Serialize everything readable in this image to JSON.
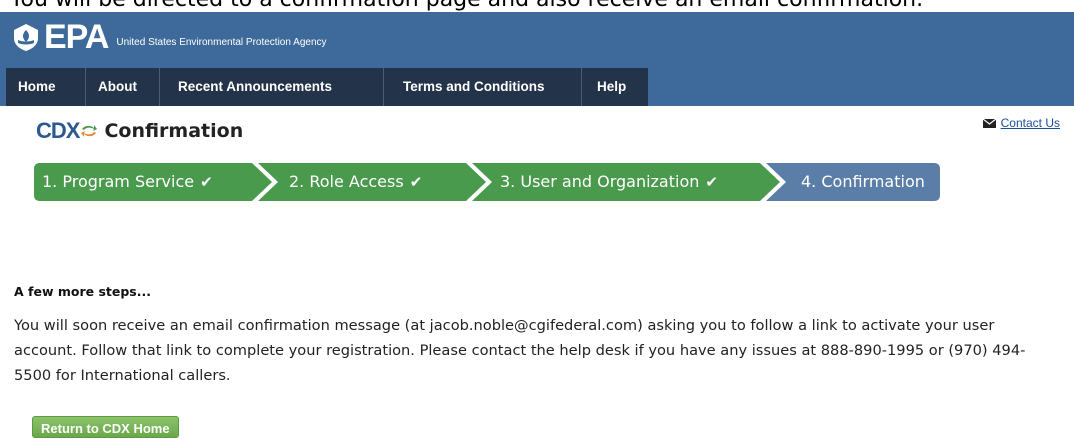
{
  "doc_caption": "You will be directed to a confirmation page and also receive an email confirmation.",
  "header": {
    "logo_text": "EPA",
    "agency_name": "United States Environmental Protection Agency"
  },
  "nav": {
    "items": [
      {
        "label": "Home"
      },
      {
        "label": "About"
      },
      {
        "label": "Recent Announcements"
      },
      {
        "label": "Terms and Conditions"
      },
      {
        "label": "Help"
      }
    ]
  },
  "contact": {
    "label": "Contact Us",
    "icon": "envelope-icon"
  },
  "title": {
    "logo_text": "CDX",
    "text": "Confirmation"
  },
  "steps": [
    {
      "label": "1. Program Service",
      "check": "✔",
      "state": "complete"
    },
    {
      "label": "2. Role Access",
      "check": "✔",
      "state": "complete"
    },
    {
      "label": "3. User and Organization",
      "check": "✔",
      "state": "complete"
    },
    {
      "label": "4. Confirmation",
      "check": "",
      "state": "current"
    }
  ],
  "colors": {
    "header_blue": "#3d6a9a",
    "nav_dark": "#23344a",
    "step_complete": "#4a9a4e",
    "step_current": "#5b7ea8",
    "button_green": "#6aa84a"
  },
  "content": {
    "heading": "A few more steps...",
    "body": "You will soon receive an email confirmation message (at jacob.noble@cgifederal.com) asking you to follow a link to activate your user account. Follow that link to complete your registration. Please contact the help desk if you have any issues at 888-890-1995 or (970) 494-5500 for International callers."
  },
  "buttons": {
    "return_label": "Return to CDX Home"
  }
}
